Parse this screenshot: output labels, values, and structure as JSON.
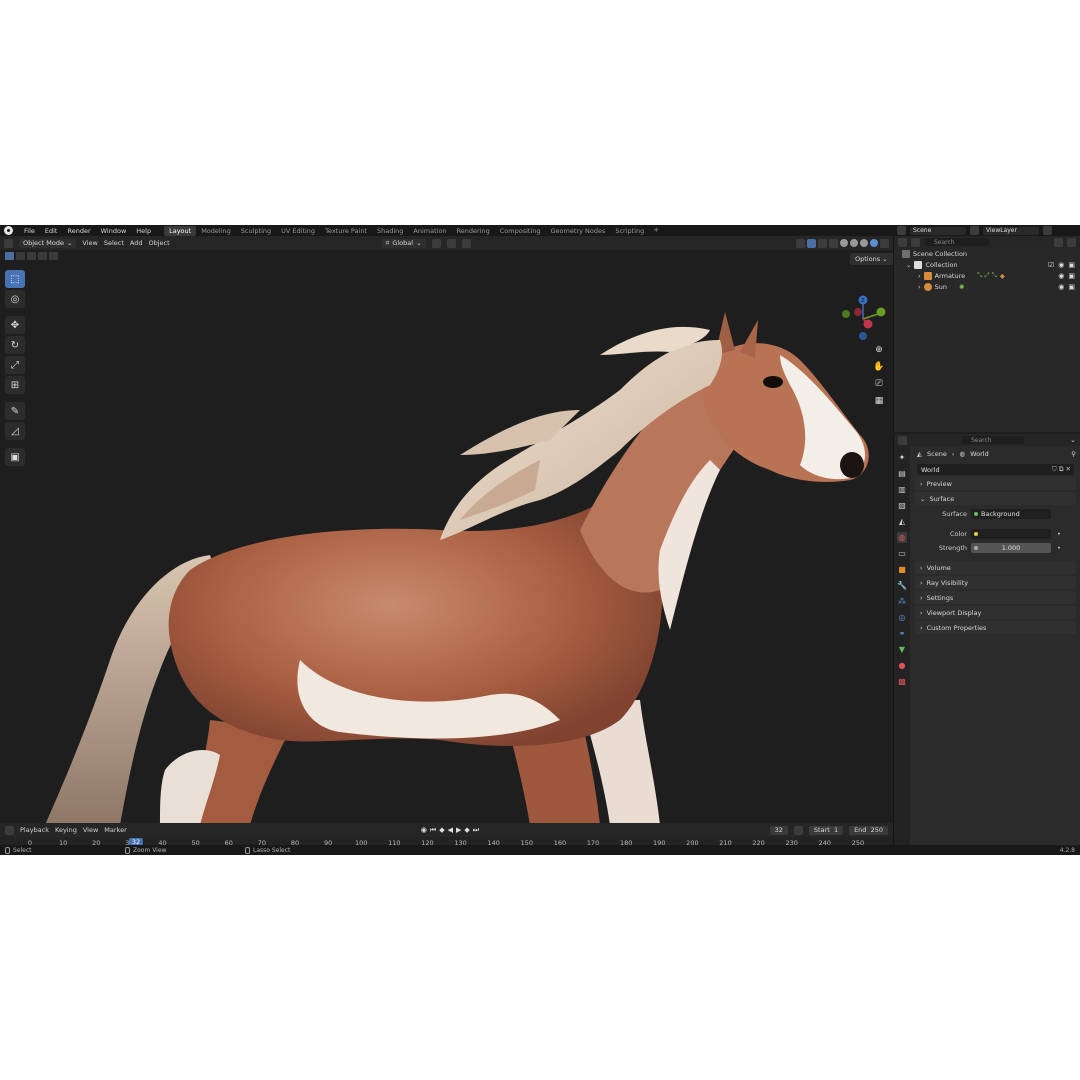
{
  "menus": [
    "File",
    "Edit",
    "Render",
    "Window",
    "Help"
  ],
  "workspaces": [
    "Layout",
    "Modeling",
    "Sculpting",
    "UV Editing",
    "Texture Paint",
    "Shading",
    "Animation",
    "Rendering",
    "Compositing",
    "Geometry Nodes",
    "Scripting"
  ],
  "workspace_add": "+",
  "scene_name": "Scene",
  "view_layer": "ViewLayer",
  "viewport_header": {
    "mode": "Object Mode",
    "view": "View",
    "select": "Select",
    "add": "Add",
    "object": "Object",
    "orientation": "Global"
  },
  "options_label": "Options",
  "gizmo": {
    "z": "Z",
    "y": "Y",
    "x": "X"
  },
  "outliner": {
    "search_placeholder": "Search",
    "scene_collection": "Scene Collection",
    "collection": "Collection",
    "items": [
      "Armature",
      "Sun"
    ]
  },
  "properties": {
    "search_placeholder": "Search",
    "breadcrumb_scene": "Scene",
    "breadcrumb_world": "World",
    "world_name": "World",
    "panels": {
      "preview": "Preview",
      "surface": "Surface",
      "volume": "Volume",
      "ray_visibility": "Ray Visibility",
      "settings": "Settings",
      "viewport_display": "Viewport Display",
      "custom_properties": "Custom Properties"
    },
    "surface_label": "Surface",
    "surface_value": "Background",
    "color_label": "Color",
    "strength_label": "Strength",
    "strength_value": "1.000"
  },
  "timeline": {
    "playback": "Playback",
    "keying": "Keying",
    "view": "View",
    "marker": "Marker",
    "current_frame": "32",
    "start_label": "Start",
    "start_value": "1",
    "end_label": "End",
    "end_value": "250",
    "ticks": [
      0,
      10,
      20,
      30,
      40,
      50,
      60,
      70,
      80,
      90,
      100,
      110,
      120,
      130,
      140,
      150,
      160,
      170,
      180,
      190,
      200,
      210,
      220,
      230,
      240,
      250
    ]
  },
  "statusbar": {
    "select": "Select",
    "zoom": "Zoom View",
    "lasso": "Lasso Select",
    "version": "4.2.8"
  },
  "colors": {
    "accent": "#4772b3",
    "gizmo_x": "#c2354a",
    "gizmo_y": "#6b9d26",
    "gizmo_z": "#3b6fbf",
    "horse_coat": "#b26b4e",
    "horse_mane": "#e4d2bf"
  }
}
